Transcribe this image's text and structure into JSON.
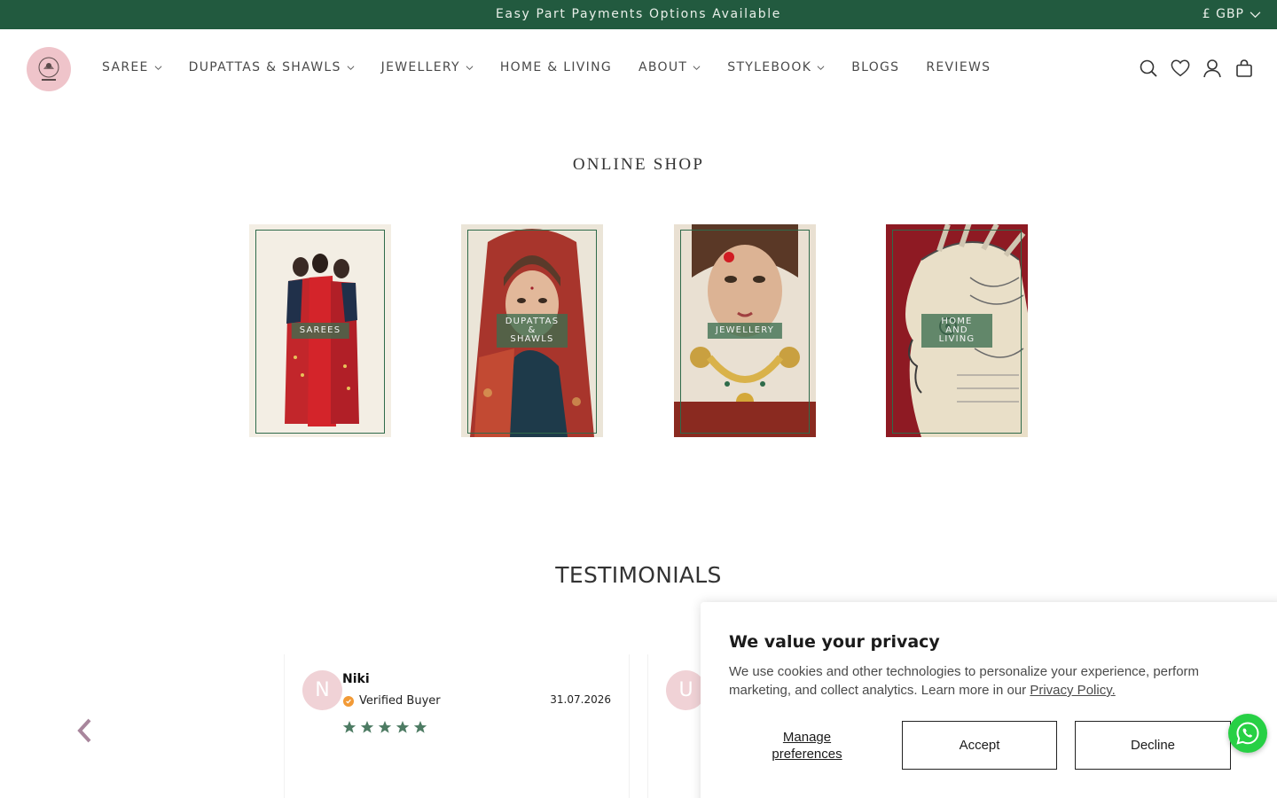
{
  "announcement": {
    "text": "Easy Part Payments Options Available",
    "currency": "£ GBP"
  },
  "nav": {
    "items": [
      {
        "label": "SAREE",
        "has_dropdown": true
      },
      {
        "label": "DUPATTAS & SHAWLS",
        "has_dropdown": true
      },
      {
        "label": "JEWELLERY",
        "has_dropdown": true
      },
      {
        "label": "HOME & LIVING",
        "has_dropdown": false
      },
      {
        "label": "ABOUT",
        "has_dropdown": true
      },
      {
        "label": "STYLEBOOK",
        "has_dropdown": true
      },
      {
        "label": "BLOGS",
        "has_dropdown": false
      },
      {
        "label": "REVIEWS",
        "has_dropdown": false
      }
    ],
    "icons": [
      "search-icon",
      "heart-icon",
      "account-icon",
      "bag-icon"
    ]
  },
  "shop": {
    "title": "ONLINE SHOP",
    "tiles": [
      {
        "label": "SAREES"
      },
      {
        "label": "DUPATTAS\n& SHAWLS"
      },
      {
        "label": "JEWELLERY"
      },
      {
        "label": "HOME AND\nLIVING"
      }
    ]
  },
  "testimonials": {
    "title": "TESTIMONIALS",
    "cards": [
      {
        "initial": "N",
        "name": "Niki",
        "verified_label": "Verified Buyer",
        "date": "31.07.2026",
        "rating": 5
      },
      {
        "initial": "U"
      }
    ]
  },
  "cookie": {
    "title": "We value your privacy",
    "body": "We use cookies and other technologies to personalize your experience, perform marketing, and collect analytics. Learn more in our ",
    "link": "Privacy Policy.",
    "manage_label": "Manage preferences",
    "accept_label": "Accept",
    "decline_label": "Decline"
  },
  "colors": {
    "announce_bg": "#225a3f",
    "star": "#4d7b63",
    "avatar": "#f0d2d6",
    "whatsapp": "#27d045"
  }
}
